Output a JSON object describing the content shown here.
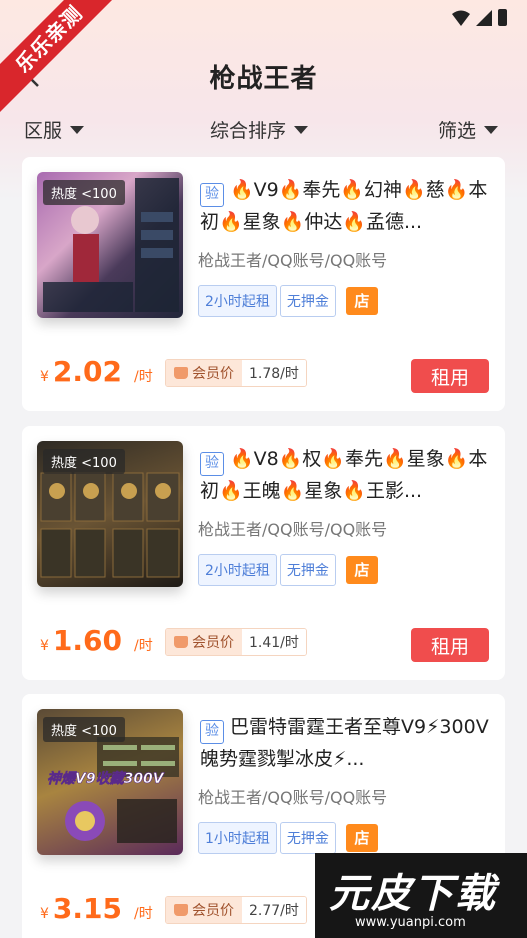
{
  "corner_ribbon": "乐乐亲测",
  "header": {
    "title": "枪战王者"
  },
  "filters": [
    {
      "label": "区服"
    },
    {
      "label": "综合排序"
    },
    {
      "label": "筛选"
    }
  ],
  "listings": [
    {
      "heat": "热度 <100",
      "verify": "验",
      "title": "🔥V9🔥奉先🔥幻神🔥慈🔥本初🔥星象🔥仲达🔥孟德...",
      "category": "枪战王者/QQ账号/QQ账号",
      "tag_rent": "2小时起租",
      "tag_deposit": "无押金",
      "shop": "店",
      "currency": "¥",
      "price": "2.02",
      "unit": "/时",
      "member_label": "会员价",
      "member_price": "1.78/时",
      "rent": "租用",
      "thumb_colors": [
        "#6a3a6e",
        "#b86a8a",
        "#2a2a44"
      ]
    },
    {
      "heat": "热度 <100",
      "verify": "验",
      "title": "🔥V8🔥权🔥奉先🔥星象🔥本初🔥王魄🔥星象🔥王影...",
      "category": "枪战王者/QQ账号/QQ账号",
      "tag_rent": "2小时起租",
      "tag_deposit": "无押金",
      "shop": "店",
      "currency": "¥",
      "price": "1.60",
      "unit": "/时",
      "member_label": "会员价",
      "member_price": "1.41/时",
      "rent": "租用",
      "thumb_colors": [
        "#3a3328",
        "#8a6a3a",
        "#1e1a16"
      ]
    },
    {
      "heat": "热度 <100",
      "verify": "验",
      "title": "巴雷特雷霆王者至尊V9⚡300V魄势霆戮掣冰皮⚡...",
      "category": "枪战王者/QQ账号/QQ账号",
      "tag_rent": "1小时起租",
      "tag_deposit": "无押金",
      "shop": "店",
      "currency": "¥",
      "price": "3.15",
      "unit": "/时",
      "member_label": "会员价",
      "member_price": "2.77/时",
      "rent": "",
      "thumb_caption": "神爆V9收藏300V",
      "thumb_colors": [
        "#4a3a2a",
        "#c79a3a",
        "#6a2a6a"
      ]
    }
  ],
  "watermark": {
    "text": "元皮下载",
    "url": "www.yuanpi.com"
  }
}
